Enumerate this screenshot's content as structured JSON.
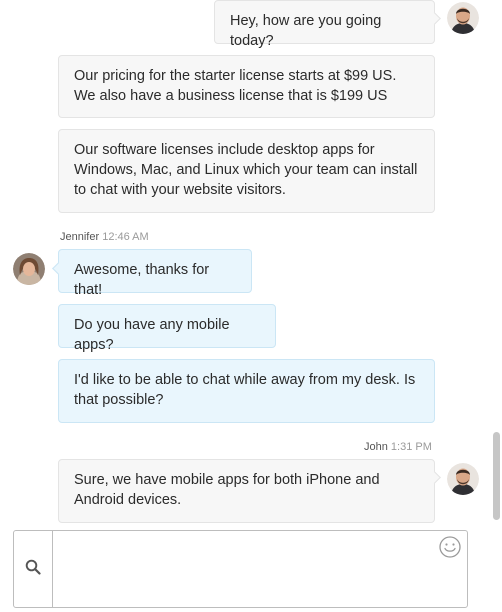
{
  "messages": [
    {
      "sender": "agent",
      "text": "Hey, how are you going today?"
    },
    {
      "sender": "agent",
      "text": "Our pricing for the starter license starts at $99 US. We also have a business license that is $199 US"
    },
    {
      "sender": "agent",
      "text": "Our software licenses include desktop apps for Windows, Mac, and Linux which your team can install to chat with your website visitors."
    },
    {
      "sender": "visitor",
      "text": "Awesome, thanks for that!"
    },
    {
      "sender": "visitor",
      "text": "Do you have any mobile apps?"
    },
    {
      "sender": "visitor",
      "text": "I'd like to be able to chat while away from my desk. Is that possible?"
    },
    {
      "sender": "agent",
      "text": "Sure, we have mobile apps for both iPhone and Android devices."
    }
  ],
  "visitor_meta": {
    "name": "Jennifer",
    "time": "12:46 AM"
  },
  "agent_meta": {
    "name": "John",
    "time": "1:31 PM"
  },
  "composer": {
    "placeholder": ""
  },
  "icons": {
    "search": "search-icon",
    "emoji": "smiley-icon"
  },
  "colors": {
    "agent_bubble": "#f7f7f7",
    "visitor_bubble": "#e9f6fd",
    "visitor_border": "#cbe6f5"
  }
}
